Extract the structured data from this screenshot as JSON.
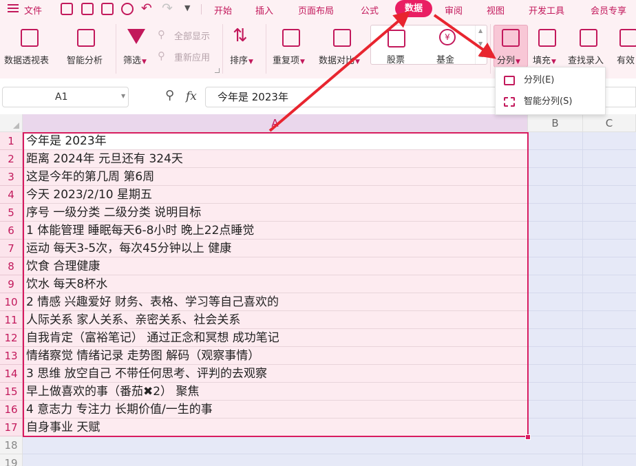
{
  "menubar": {
    "file_label": "文件",
    "tabs": [
      "开始",
      "插入",
      "页面布局",
      "公式",
      "数据",
      "审阅",
      "视图",
      "开发工具",
      "会员专享"
    ],
    "active_tab": "数据"
  },
  "ribbon": {
    "pivot_label": "数据透视表",
    "smart_analysis_label": "智能分析",
    "filter_label": "筛选",
    "show_all_label": "全部显示",
    "reapply_label": "重新应用",
    "sort_label": "排序",
    "duplicates_label": "重复项",
    "compare_label": "数据对比",
    "stocks_label": "股票",
    "funds_label": "基金",
    "split_label": "分列",
    "fill_label": "填充",
    "lookup_label": "查找录入",
    "valid_label": "有效"
  },
  "split_menu": {
    "items": [
      "分列(E)",
      "智能分列(S)"
    ]
  },
  "formula_bar": {
    "cell_ref": "A1",
    "fx_label": "fx",
    "content": "今年是 2023年"
  },
  "columns": [
    "A",
    "B",
    "C"
  ],
  "rows": [
    {
      "num": "1",
      "a": "今年是 2023年"
    },
    {
      "num": "2",
      "a": "距离 2024年 元旦还有 324天"
    },
    {
      "num": "3",
      "a": "这是今年的第几周 第6周"
    },
    {
      "num": "4",
      "a": "今天 2023/2/10 星期五"
    },
    {
      "num": "5",
      "a": "序号 一级分类 二级分类 说明目标"
    },
    {
      "num": "6",
      "a": "1 体能管理 睡眠每天6-8小时 晚上22点睡觉"
    },
    {
      "num": "7",
      "a": "运动 每天3-5次，每次45分钟以上 健康"
    },
    {
      "num": "8",
      "a": "饮食 合理健康"
    },
    {
      "num": "9",
      "a": "饮水 每天8杯水"
    },
    {
      "num": "10",
      "a": "2 情感 兴趣爱好 财务、表格、学习等自己喜欢的"
    },
    {
      "num": "11",
      "a": "人际关系 家人关系、亲密关系、社会关系"
    },
    {
      "num": "12",
      "a": "自我肯定（富裕笔记） 通过正念和冥想 成功笔记"
    },
    {
      "num": "13",
      "a": "情绪察觉 情绪记录 走势图 解码（观察事情）"
    },
    {
      "num": "14",
      "a": "3 思维 放空自己 不带任何思考、评判的去观察"
    },
    {
      "num": "15",
      "a": "早上做喜欢的事（番茄✖2） 聚焦"
    },
    {
      "num": "16",
      "a": "4 意志力 专注力 长期价值/一生的事"
    },
    {
      "num": "17",
      "a": "自身事业 天赋"
    },
    {
      "num": "18",
      "a": ""
    },
    {
      "num": "19",
      "a": ""
    }
  ],
  "colors": {
    "accent": "#e91e63",
    "annotation_red": "#e8252f"
  }
}
